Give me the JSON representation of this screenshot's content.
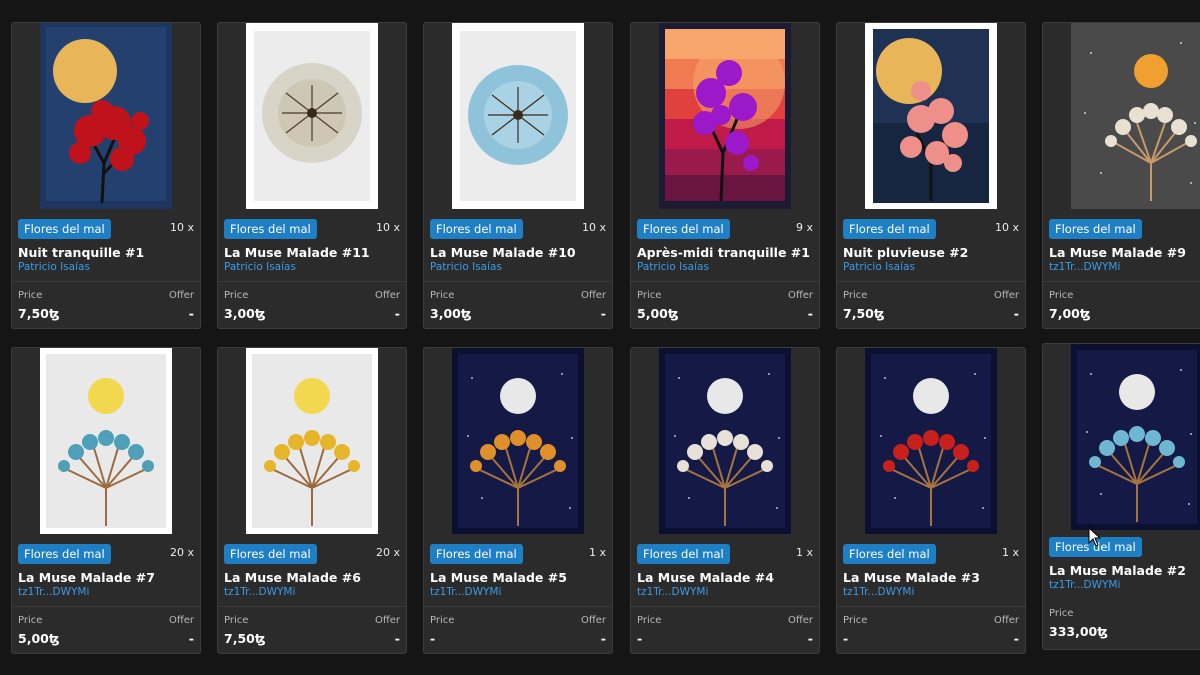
{
  "labels": {
    "price": "Price",
    "offer": "Offer"
  },
  "cards": [
    {
      "tag": "Flores del mal",
      "qty": "10 x",
      "title": "Nuit tranquille #1",
      "creator": "Patricio Isaías",
      "price": "7,50ꜩ",
      "offer": "-"
    },
    {
      "tag": "Flores del mal",
      "qty": "10 x",
      "title": "La Muse Malade #11",
      "creator": "Patricio Isaías",
      "price": "3,00ꜩ",
      "offer": "-"
    },
    {
      "tag": "Flores del mal",
      "qty": "10 x",
      "title": "La Muse Malade #10",
      "creator": "Patricio Isaías",
      "price": "3,00ꜩ",
      "offer": "-"
    },
    {
      "tag": "Flores del mal",
      "qty": "9 x",
      "title": "Après-midi tranquille #1",
      "creator": "Patricio Isaías",
      "price": "5,00ꜩ",
      "offer": "-"
    },
    {
      "tag": "Flores del mal",
      "qty": "10 x",
      "title": "Nuit pluvieuse #2",
      "creator": "Patricio Isaías",
      "price": "7,50ꜩ",
      "offer": "-"
    },
    {
      "tag": "Flores del mal",
      "qty": "",
      "title": "La Muse Malade #9",
      "creator": "tz1Tr...DWYMi",
      "price": "7,00ꜩ",
      "offer": ""
    },
    {
      "tag": "Flores del mal",
      "qty": "20 x",
      "title": "La Muse Malade #7",
      "creator": "tz1Tr...DWYMi",
      "price": "5,00ꜩ",
      "offer": "-"
    },
    {
      "tag": "Flores del mal",
      "qty": "20 x",
      "title": "La Muse Malade #6",
      "creator": "tz1Tr...DWYMi",
      "price": "7,50ꜩ",
      "offer": "-"
    },
    {
      "tag": "Flores del mal",
      "qty": "1 x",
      "title": "La Muse Malade #5",
      "creator": "tz1Tr...DWYMi",
      "price": "-",
      "offer": "-"
    },
    {
      "tag": "Flores del mal",
      "qty": "1 x",
      "title": "La Muse Malade #4",
      "creator": "tz1Tr...DWYMi",
      "price": "-",
      "offer": "-"
    },
    {
      "tag": "Flores del mal",
      "qty": "1 x",
      "title": "La Muse Malade #3",
      "creator": "tz1Tr...DWYMi",
      "price": "-",
      "offer": "-"
    },
    {
      "tag": "Flores del mal",
      "qty": "",
      "title": "La Muse Malade #2",
      "creator": "tz1Tr...DWYMi",
      "price": "333,00ꜩ",
      "offer": ""
    }
  ]
}
